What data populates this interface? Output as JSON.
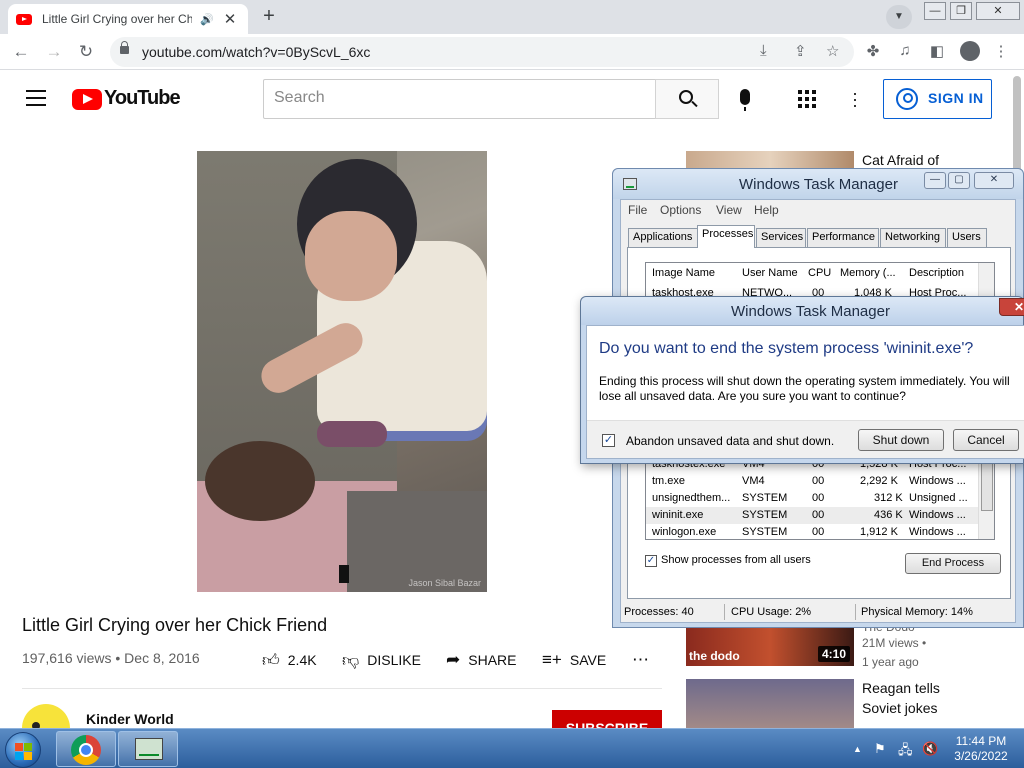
{
  "browser": {
    "tab_title": "Little Girl Crying over her Chi",
    "url": "youtube.com/watch?v=0ByScvL_6xc"
  },
  "youtube": {
    "logo_text": "YouTube",
    "search_placeholder": "Search",
    "signin_label": "SIGN IN"
  },
  "video": {
    "watermark": "Jason Sibal Bazar",
    "title": "Little Girl Crying over her Chick Friend",
    "meta": "197,616 views • Dec 8, 2016",
    "likes": "2.4K",
    "dislike_label": "DISLIKE",
    "share_label": "SHARE",
    "save_label": "SAVE",
    "channel_name": "Kinder World",
    "subscribe_label": "SUBSCRIBE"
  },
  "sidebar": [
    {
      "title": "Cat Afraid of"
    },
    {
      "title": "The Dodo",
      "views": "21M views •",
      "age": "1 year ago",
      "duration": "4:10",
      "logo": "the dodo"
    },
    {
      "title_line1": "Reagan tells",
      "title_line2": "Soviet jokes"
    }
  ],
  "task_manager": {
    "title": "Windows Task Manager",
    "menu": [
      "File",
      "Options",
      "View",
      "Help"
    ],
    "tabs": [
      "Applications",
      "Processes",
      "Services",
      "Performance",
      "Networking",
      "Users"
    ],
    "columns": [
      "Image Name",
      "User Name",
      "CPU",
      "Memory (...",
      "Description"
    ],
    "rows": [
      {
        "name": "taskhost.exe",
        "user": "NETWO...",
        "cpu": "00",
        "mem": "1,048 K",
        "desc": "Host Proc..."
      },
      {
        "name": "taskhostex.exe",
        "user": "VM4",
        "cpu": "00",
        "mem": "1,528 K",
        "desc": "Host Proc..."
      },
      {
        "name": "tm.exe",
        "user": "VM4",
        "cpu": "00",
        "mem": "2,292 K",
        "desc": "Windows ..."
      },
      {
        "name": "unsignedthem...",
        "user": "SYSTEM",
        "cpu": "00",
        "mem": "312 K",
        "desc": "Unsigned ..."
      },
      {
        "name": "wininit.exe",
        "user": "SYSTEM",
        "cpu": "00",
        "mem": "436 K",
        "desc": "Windows ..."
      },
      {
        "name": "winlogon.exe",
        "user": "SYSTEM",
        "cpu": "00",
        "mem": "1,912 K",
        "desc": "Windows ..."
      }
    ],
    "show_all_label": "Show processes from all users",
    "end_process_label": "End Process",
    "status_processes": "Processes: 40",
    "status_cpu": "CPU Usage: 2%",
    "status_memory": "Physical Memory: 14%"
  },
  "dialog": {
    "title": "Windows Task Manager",
    "question": "Do you want to end the system process 'wininit.exe'?",
    "text": "Ending this process will shut down the operating system immediately.  You will lose all unsaved data.  Are you sure you want to continue?",
    "checkbox_label": "Abandon unsaved data and shut down.",
    "shutdown_label": "Shut down",
    "cancel_label": "Cancel"
  },
  "taskbar": {
    "time": "11:44 PM",
    "date": "3/26/2022"
  }
}
